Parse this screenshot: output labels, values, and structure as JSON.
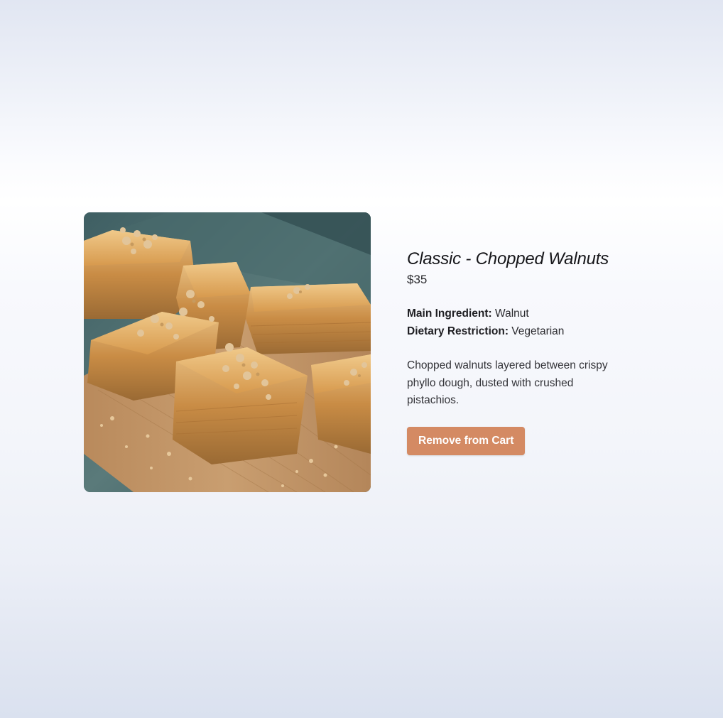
{
  "product": {
    "title": "Classic - Chopped Walnuts",
    "price": "$35",
    "image_alt": "baklava-photo",
    "attributes": [
      {
        "label": "Main Ingredient:",
        "value": "Walnut"
      },
      {
        "label": "Dietary Restriction:",
        "value": "Vegetarian"
      }
    ],
    "description": "Chopped walnuts layered between crispy phyllo dough, dusted with crushed pistachios.",
    "action_label": "Remove from Cart"
  },
  "colors": {
    "button_bg": "#d48a63",
    "button_text": "#ffffff",
    "title_text": "#16161a"
  }
}
